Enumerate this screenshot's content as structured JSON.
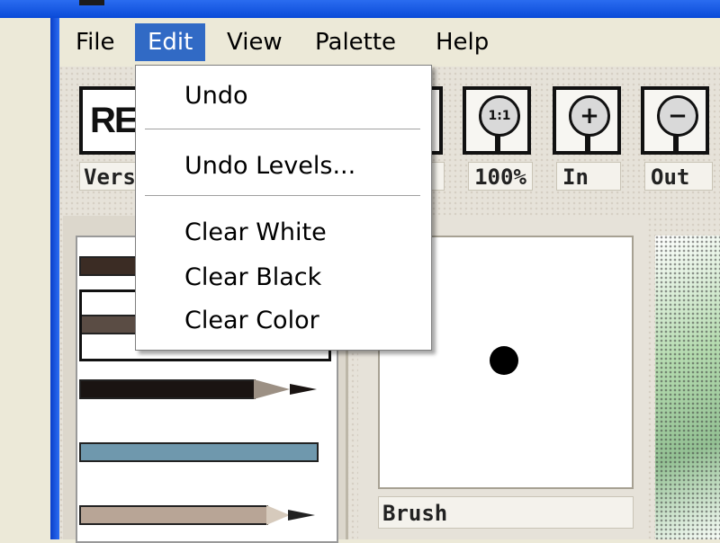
{
  "menubar": {
    "items": [
      {
        "label": "File"
      },
      {
        "label": "Edit"
      },
      {
        "label": "View"
      },
      {
        "label": "Palette"
      },
      {
        "label": "Help"
      }
    ],
    "active": "Edit"
  },
  "toolbar": {
    "logo_text": "RE",
    "version_label": "Version",
    "buttons": [
      {
        "icon": "1:1",
        "label": "100%"
      },
      {
        "icon": "+",
        "label": "In"
      },
      {
        "icon": "−",
        "label": "Out"
      }
    ]
  },
  "edit_menu": {
    "items": [
      {
        "label": "Undo"
      },
      {
        "label": "Undo Levels..."
      },
      {
        "label": "Clear White"
      },
      {
        "label": "Clear Black"
      },
      {
        "label": "Clear Color"
      }
    ]
  },
  "brush_panel": {
    "label": "Brush"
  },
  "colors": {
    "menu_highlight": "#316ac5",
    "titlebar": "#0a4ad8",
    "pencil_dark_brown": "#3b2c24",
    "pencil_gray_brown": "#5a4c44",
    "pencil_black": "#1a1412",
    "pencil_blue": "#6f98ad",
    "pencil_tan": "#b8a596"
  }
}
